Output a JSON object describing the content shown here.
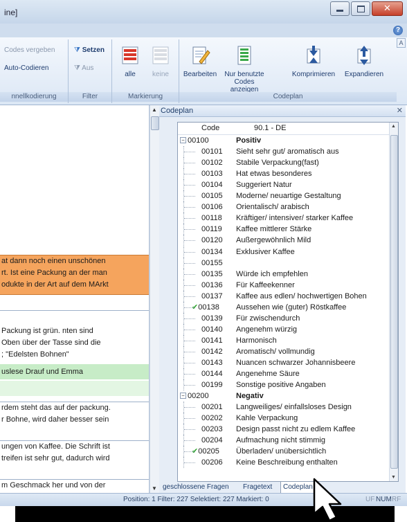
{
  "window": {
    "title": "ine]"
  },
  "ribbon": {
    "groups": {
      "handkodierung": {
        "label": "nnellkodierung",
        "buttons": [
          {
            "label": "Codes vergeben",
            "enabled": false
          },
          {
            "label": "Auto-Codieren",
            "enabled": true
          }
        ]
      },
      "filter": {
        "label": "Filter",
        "buttons": [
          {
            "label": "Setzen",
            "enabled": true
          },
          {
            "label": "Aus",
            "enabled": false
          }
        ]
      },
      "markierung": {
        "label": "Markierung",
        "buttons": [
          {
            "label": "alle",
            "enabled": true
          },
          {
            "label": "keine",
            "enabled": false
          }
        ]
      },
      "codeplan": {
        "label": "Codeplan",
        "buttons": [
          {
            "label": "Bearbeiten",
            "enabled": true
          },
          {
            "label": "Nur benutzte",
            "label2": "Codes anzeigen",
            "enabled": true
          },
          {
            "label": "Komprimieren",
            "enabled": true
          },
          {
            "label": "Expandieren",
            "enabled": true
          }
        ]
      }
    }
  },
  "left_pane": {
    "records": [
      {
        "lines": [
          "at dann noch einen unschönen",
          "rt. Ist eine Packung an der man",
          "odukte  in der Art auf dem MArkt"
        ],
        "style": "orange"
      },
      {
        "lines": [
          " Packung ist grün. nten sind",
          "Oben über der Tasse sind die",
          "; \"Edelsten Bohnen\""
        ],
        "style": "white"
      },
      {
        "lines": [
          "uslese Drauf und Emma"
        ],
        "style": "green"
      },
      {
        "lines": [
          ""
        ],
        "style": "lightgreen"
      },
      {
        "lines": [
          "rdem steht das auf der packung.",
          "r Bohne, wird daher besser sein"
        ],
        "style": "white"
      },
      {
        "lines": [
          "ungen von Kaffee. Die Schrift ist",
          "treifen ist sehr gut, dadurch wird"
        ],
        "style": "white"
      },
      {
        "lines": [
          "m Geschmack her und von der"
        ],
        "style": "white"
      }
    ]
  },
  "codeplan": {
    "panel_title": "Codeplan",
    "columns": {
      "code": "Code",
      "desc": "90.1 - DE"
    },
    "rows": [
      {
        "code": "00100",
        "desc": "Positiv",
        "level": 0,
        "expander": "−"
      },
      {
        "code": "00101",
        "desc": "Sieht sehr gut/ aromatisch aus",
        "level": 1
      },
      {
        "code": "00102",
        "desc": "Stabile Verpackung(fast)",
        "level": 1
      },
      {
        "code": "00103",
        "desc": "Hat etwas besonderes",
        "level": 1
      },
      {
        "code": "00104",
        "desc": "Suggeriert Natur",
        "level": 1
      },
      {
        "code": "00105",
        "desc": "Moderne/ neuartige Gestaltung",
        "level": 1
      },
      {
        "code": "00106",
        "desc": "Orientalisch/ arabisch",
        "level": 1
      },
      {
        "code": "00118",
        "desc": "Kräftiger/ intensiver/ starker Kaffee",
        "level": 1
      },
      {
        "code": "00119",
        "desc": "Kaffee mittlerer Stärke",
        "level": 1
      },
      {
        "code": "00120",
        "desc": "Außergewöhnlich Mild",
        "level": 1
      },
      {
        "code": "00134",
        "desc": "Exklusiver Kaffee",
        "level": 1
      },
      {
        "code": "00155",
        "desc": "",
        "level": 1
      },
      {
        "code": "00135",
        "desc": "Würde ich empfehlen",
        "level": 1
      },
      {
        "code": "00136",
        "desc": "Für Kaffeekenner",
        "level": 1
      },
      {
        "code": "00137",
        "desc": "Kaffee aus edlen/ hochwertigen Bohen",
        "level": 1
      },
      {
        "code": "00138",
        "desc": "Aussehen wie (guter) Röstkaffee",
        "level": 1,
        "checked": true
      },
      {
        "code": "00139",
        "desc": "Für zwischendurch",
        "level": 1
      },
      {
        "code": "00140",
        "desc": "Angenehm würzig",
        "level": 1
      },
      {
        "code": "00141",
        "desc": "Harmonisch",
        "level": 1
      },
      {
        "code": "00142",
        "desc": "Aromatisch/ vollmundig",
        "level": 1
      },
      {
        "code": "00143",
        "desc": "Nuancen schwarzer Johannisbeere",
        "level": 1
      },
      {
        "code": "00144",
        "desc": "Angenehme Säure",
        "level": 1
      },
      {
        "code": "00199",
        "desc": "Sonstige positive Angaben",
        "level": 1
      },
      {
        "code": "00200",
        "desc": "Negativ",
        "level": 0,
        "expander": "−"
      },
      {
        "code": "00201",
        "desc": "Langweiliges/ einfallsloses Design",
        "level": 1
      },
      {
        "code": "00202",
        "desc": "Kahle Verpackung",
        "level": 1
      },
      {
        "code": "00203",
        "desc": "Design passt nicht zu edlem Kaffee",
        "level": 1
      },
      {
        "code": "00204",
        "desc": "Aufmachung nicht stimmig",
        "level": 1
      },
      {
        "code": "00205",
        "desc": "Überladen/ unübersichtlich",
        "level": 1,
        "checked": true
      },
      {
        "code": "00206",
        "desc": "Keine Beschreibung enthalten",
        "level": 1
      }
    ],
    "bottom_tabs": [
      "geschlossene Fragen",
      "Fragetext",
      "Codeplan"
    ],
    "active_tab": 2
  },
  "status": {
    "text": "Position: 1 Filter: 227 Selektiert: 227 Markiert: 0",
    "indicators": [
      "UF",
      "NUM",
      "RF"
    ]
  },
  "colors": {
    "orange_row": "#f5a45d",
    "green_row": "#c7ecc7",
    "check": "#2aa42a",
    "ribbon_bg": "#dce7f5"
  }
}
